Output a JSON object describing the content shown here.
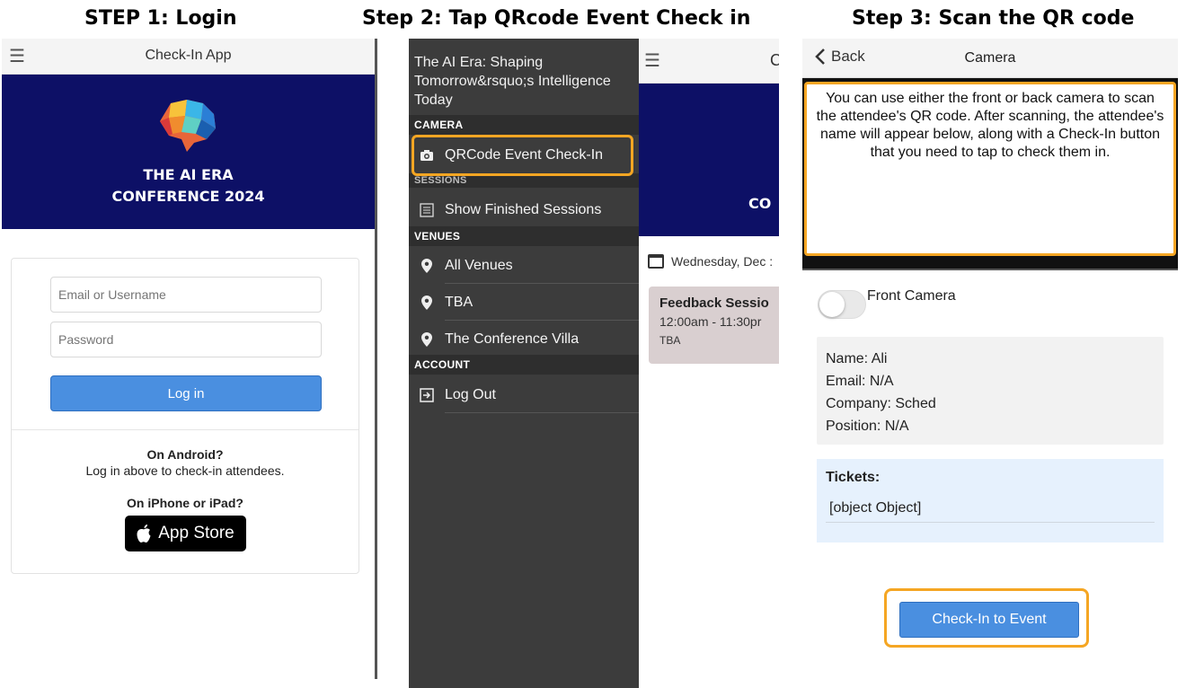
{
  "steps": {
    "step1": "STEP 1: Login",
    "step2": "Step 2: Tap QRcode Event Check in",
    "step3": "Step 3: Scan the QR code"
  },
  "login_screen": {
    "app_title": "Check-In App",
    "conference_line1": "THE AI ERA",
    "conference_line2": "CONFERENCE 2024",
    "email_placeholder": "Email or Username",
    "password_placeholder": "Password",
    "login_button": "Log in",
    "android_heading": "On Android?",
    "android_text": "Log in above to check-in attendees.",
    "ios_heading": "On iPhone or iPad?",
    "app_store_label": "App Store"
  },
  "menu_screen": {
    "event_title": "The AI Era: Shaping Tomorrow&rsquo;s Intelligence Today",
    "sections": {
      "camera": "CAMERA",
      "sessions": "SESSIONS",
      "venues": "VENUES",
      "account": "ACCOUNT"
    },
    "items": {
      "qrcode": "QRCode Event Check-In",
      "finished": "Show Finished Sessions",
      "all_venues": "All Venues",
      "tba": "TBA",
      "villa": "The Conference Villa",
      "logout": "Log Out"
    },
    "background": {
      "title_fragment": "C",
      "conf_fragment": "CO",
      "date": "Wednesday, Dec :",
      "session_title": "Feedback Sessio",
      "session_time": "12:00am - 11:30pr",
      "session_location": "TBA"
    }
  },
  "camera_screen": {
    "back_label": "Back",
    "title": "Camera",
    "instruction": "You can use either the front or back camera to scan the attendee's QR code. After scanning, the attendee's name will appear below, along with a Check-In button that you need to tap to check them in.",
    "front_camera_label": "Front Camera",
    "name": "Name: Ali",
    "email": "Email: N/A",
    "company": "Company: Sched",
    "position": "Position: N/A",
    "tickets_heading": "Tickets:",
    "tickets_value": "[object Object]",
    "checkin_button": "Check-In to Event"
  },
  "colors": {
    "hero_navy": "#0d1066",
    "accent_blue": "#4a8fe0",
    "highlight_orange": "#f5a623",
    "menu_dark": "#3c3c3c"
  }
}
